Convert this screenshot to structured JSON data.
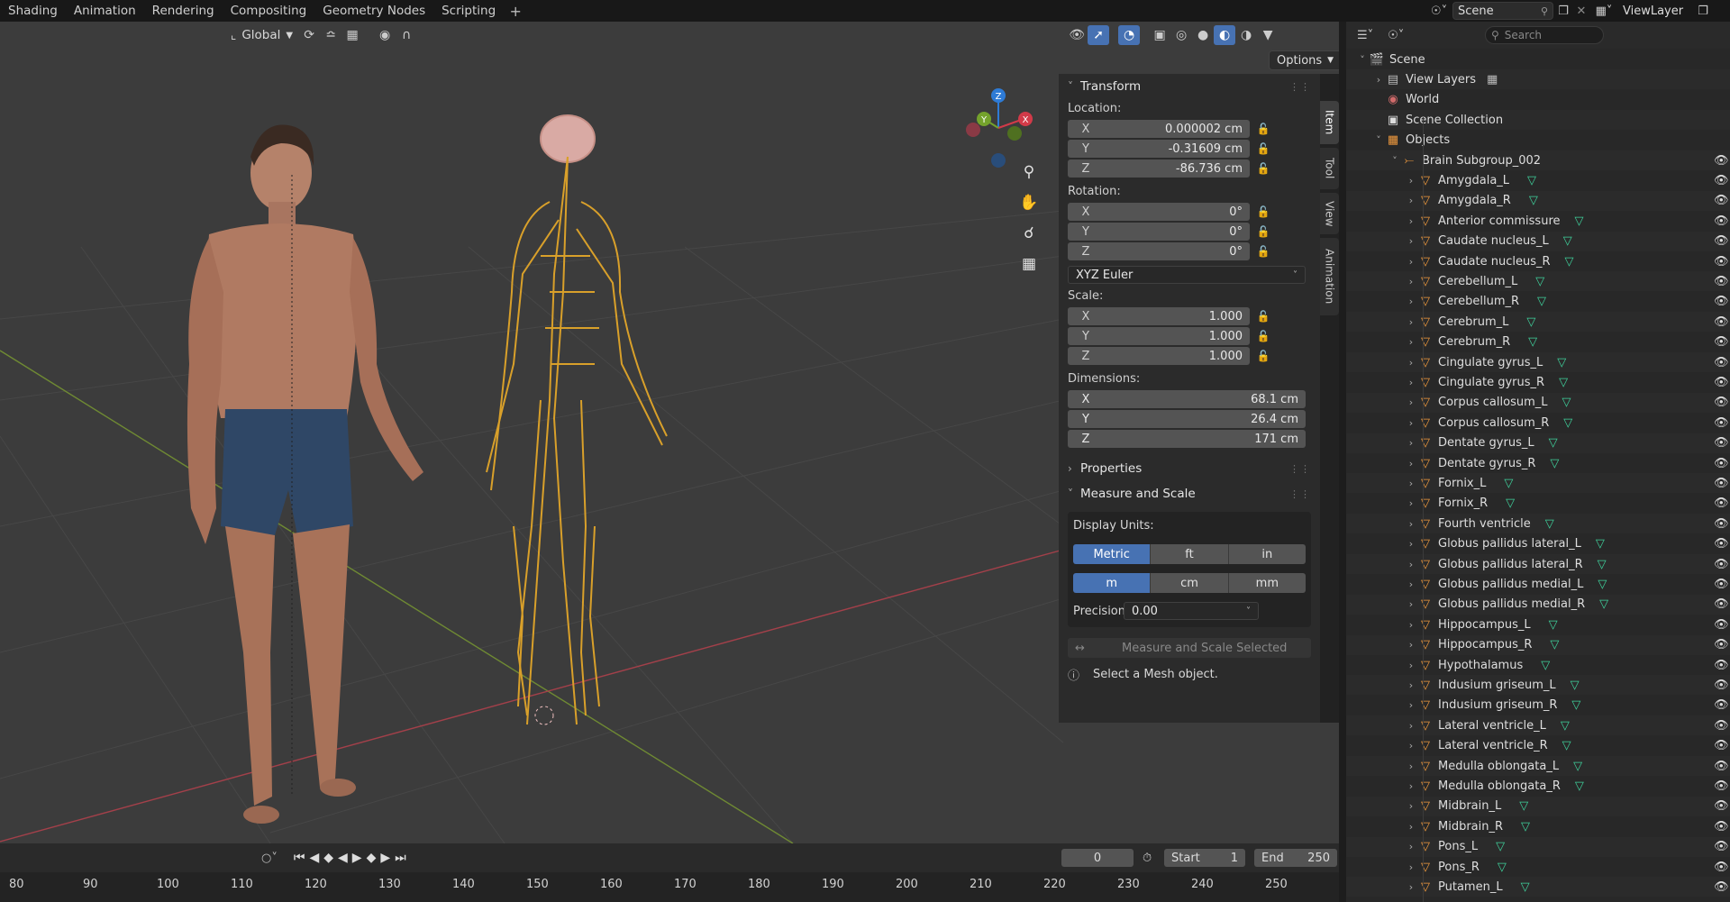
{
  "workspace_tabs": [
    "Shading",
    "Animation",
    "Rendering",
    "Compositing",
    "Geometry Nodes",
    "Scripting"
  ],
  "scene_name": "Scene",
  "view_layer": "ViewLayer",
  "viewport": {
    "transform_orientation": "Global",
    "options_label": "Options"
  },
  "npanel": {
    "tabs": [
      "Item",
      "Tool",
      "View",
      "Animation"
    ],
    "transform_title": "Transform",
    "location_label": "Location:",
    "location": {
      "x": "0.000002 cm",
      "y": "-0.31609 cm",
      "z": "-86.736 cm"
    },
    "rotation_label": "Rotation:",
    "rotation": {
      "x": "0°",
      "y": "0°",
      "z": "0°"
    },
    "rotation_mode": "XYZ Euler",
    "scale_label": "Scale:",
    "scale": {
      "x": "1.000",
      "y": "1.000",
      "z": "1.000"
    },
    "dimensions_label": "Dimensions:",
    "dimensions": {
      "x": "68.1 cm",
      "y": "26.4 cm",
      "z": "171 cm"
    },
    "properties_title": "Properties",
    "measure_title": "Measure and Scale",
    "display_units_label": "Display Units:",
    "unit_systems": [
      "Metric",
      "ft",
      "in"
    ],
    "unit_scales": [
      "m",
      "cm",
      "mm"
    ],
    "precision_label": "Precision:",
    "precision_value": "0.00",
    "measure_button": "Measure and Scale Selected",
    "info_text": "Select a Mesh object."
  },
  "axes": {
    "x": "X",
    "y": "Y",
    "z": "Z"
  },
  "timeline": {
    "current_frame": "0",
    "start_label": "Start",
    "start": "1",
    "end_label": "End",
    "end": "250",
    "ruler": [
      "80",
      "90",
      "100",
      "110",
      "120",
      "130",
      "140",
      "150",
      "160",
      "170",
      "180",
      "190",
      "200",
      "210",
      "220",
      "230",
      "240",
      "250"
    ]
  },
  "outliner": {
    "search_placeholder": "Search",
    "scene": "Scene",
    "view_layers": "View Layers",
    "world": "World",
    "scene_collection": "Scene Collection",
    "objects": "Objects",
    "group": "Brain Subgroup_002",
    "items": [
      "Amygdala_L",
      "Amygdala_R",
      "Anterior commissure",
      "Caudate nucleus_L",
      "Caudate nucleus_R",
      "Cerebellum_L",
      "Cerebellum_R",
      "Cerebrum_L",
      "Cerebrum_R",
      "Cingulate gyrus_L",
      "Cingulate gyrus_R",
      "Corpus callosum_L",
      "Corpus callosum_R",
      "Dentate gyrus_L",
      "Dentate gyrus_R",
      "Fornix_L",
      "Fornix_R",
      "Fourth ventricle",
      "Globus pallidus lateral_L",
      "Globus pallidus lateral_R",
      "Globus pallidus medial_L",
      "Globus pallidus medial_R",
      "Hippocampus_L",
      "Hippocampus_R",
      "Hypothalamus",
      "Indusium griseum_L",
      "Indusium griseum_R",
      "Lateral ventricle_L",
      "Lateral ventricle_R",
      "Medulla oblongata_L",
      "Medulla oblongata_R",
      "Midbrain_L",
      "Midbrain_R",
      "Pons_L",
      "Pons_R",
      "Putamen_L"
    ]
  },
  "colors": {
    "accent": "#4772b3",
    "mesh_icon": "#f09a3e",
    "data_icon": "#3fd29c",
    "nerves": "#d9a02a"
  }
}
